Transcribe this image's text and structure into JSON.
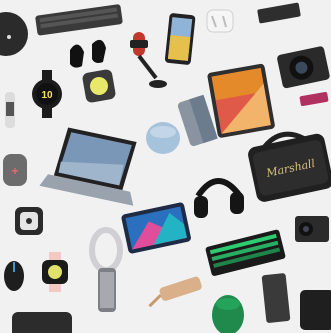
{
  "scene": {
    "background_color": "#f1f1f1",
    "devices": [
      {
        "name": "smart-speaker-round-icon",
        "color": "#2b2b2b"
      },
      {
        "name": "keyboard-icon",
        "color": "#3a3a3a"
      },
      {
        "name": "smartphone-icon",
        "color": "#222222"
      },
      {
        "name": "earbuds-case-icon",
        "color": "#f5f5f5"
      },
      {
        "name": "camera-icon",
        "color": "#2a2a2a"
      },
      {
        "name": "wireless-earbuds-icon",
        "color": "#111111"
      },
      {
        "name": "microphone-icon",
        "color": "#c0392b"
      },
      {
        "name": "smartwatch-icon",
        "color": "#1c1c1c"
      },
      {
        "name": "smart-light-icon",
        "color": "#e8e86a"
      },
      {
        "name": "tablet-icon",
        "color": "#2f2f2f"
      },
      {
        "name": "fitness-band-icon",
        "color": "#dcdcdc"
      },
      {
        "name": "external-drive-icon",
        "color": "#b03060"
      },
      {
        "name": "portable-speaker-icon",
        "color": "#6c6c6c"
      },
      {
        "name": "laptop-icon",
        "color": "#9aa3ad"
      },
      {
        "name": "smart-speaker-icon",
        "color": "#a7c3dc"
      },
      {
        "name": "phone-case-icon",
        "color": "#8a94a0"
      },
      {
        "name": "bluetooth-speaker-icon",
        "color": "#202020"
      },
      {
        "name": "headphones-icon",
        "color": "#151515"
      },
      {
        "name": "tracker-icon",
        "color": "#e5e5e5"
      },
      {
        "name": "tablet-colorful-icon",
        "color": "#1f2a44"
      },
      {
        "name": "mechanical-keyboard-icon",
        "color": "#1a1a1a"
      },
      {
        "name": "action-camera-icon",
        "color": "#2b2b2b"
      },
      {
        "name": "gaming-mouse-icon",
        "color": "#1e1e1e"
      },
      {
        "name": "pink-watch-icon",
        "color": "#f2c9c4"
      },
      {
        "name": "air-purifier-fan-icon",
        "color": "#cfcfd4"
      },
      {
        "name": "usb-hub-icon",
        "color": "#d9b089"
      },
      {
        "name": "green-speaker-icon",
        "color": "#1f8a4c"
      },
      {
        "name": "power-bank-icon",
        "color": "#3a3a3a"
      },
      {
        "name": "laptop-bag-icon",
        "color": "#2c2c2c"
      }
    ],
    "speaker_brand": "Marshall",
    "watch_face_number": "10"
  }
}
